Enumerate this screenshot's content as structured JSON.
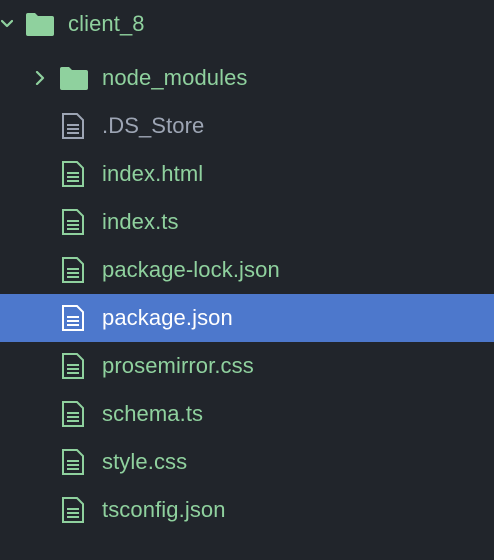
{
  "tree": {
    "root": {
      "label": "client_8",
      "expanded": true,
      "icon": "folder-icon"
    },
    "items": [
      {
        "label": "node_modules",
        "kind": "folder",
        "expanded": false,
        "status": "added"
      },
      {
        "label": ".DS_Store",
        "kind": "file",
        "status": "ignored"
      },
      {
        "label": "index.html",
        "kind": "file",
        "status": "added"
      },
      {
        "label": "index.ts",
        "kind": "file",
        "status": "added"
      },
      {
        "label": "package-lock.json",
        "kind": "file",
        "status": "added"
      },
      {
        "label": "package.json",
        "kind": "file",
        "status": "selected"
      },
      {
        "label": "prosemirror.css",
        "kind": "file",
        "status": "added"
      },
      {
        "label": "schema.ts",
        "kind": "file",
        "status": "added"
      },
      {
        "label": "style.css",
        "kind": "file",
        "status": "added"
      },
      {
        "label": "tsconfig.json",
        "kind": "file",
        "status": "added"
      }
    ]
  },
  "colors": {
    "background": "#21252b",
    "selection": "#4d78cc",
    "added_text": "#8fd19e",
    "ignored_text": "#9da5b4",
    "selected_text": "#ffffff"
  }
}
